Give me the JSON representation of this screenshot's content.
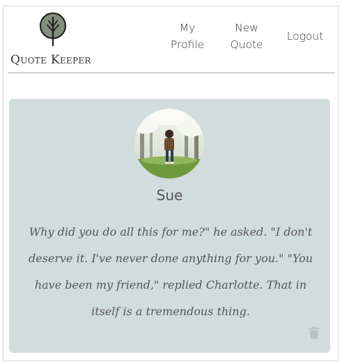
{
  "brand": {
    "name": "Quote Keeper",
    "logo_icon": "tree-icon"
  },
  "nav": {
    "my_profile": "My Profile",
    "new_quote": "New Quote",
    "logout": "Logout"
  },
  "quote_card": {
    "username": "Sue",
    "avatar_icon": "user-avatar",
    "quote_text": "Why did you do all this for me?\" he asked. \"I don't deserve it. I've never done anything for you.\" \"You have been my friend,\" replied Charlotte. That in itself is a tremendous thing.",
    "delete_icon": "trash-icon"
  },
  "colors": {
    "card_background": "#d1dcdc",
    "logo_fill": "#7f8f7b",
    "divider": "#a9a9a9"
  }
}
